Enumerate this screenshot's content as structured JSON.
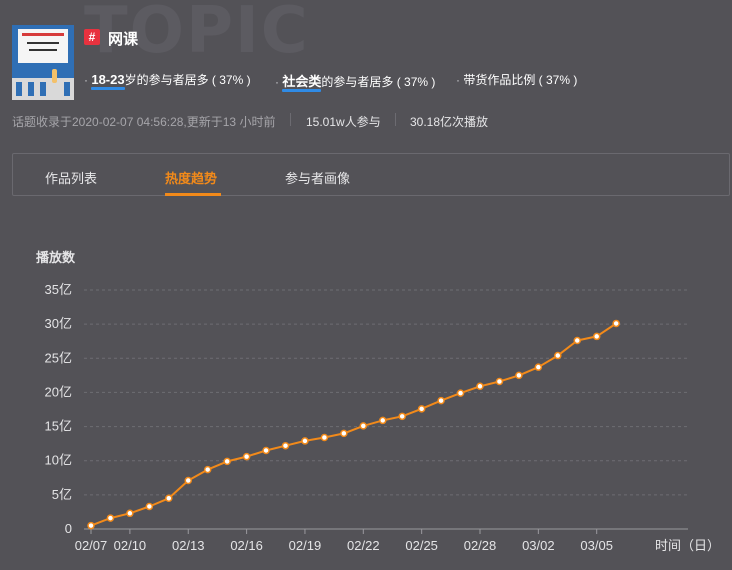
{
  "watermark": "TOPIC",
  "topic": {
    "hash_symbol": "#",
    "title": "网课",
    "cover_icon": "topic-cover-thumbnail"
  },
  "stats": [
    {
      "dot": "·",
      "highlight": "18-23",
      "rest": "岁的参与者居多 ( 37% )"
    },
    {
      "dot": "·",
      "highlight": "社会类",
      "rest": "的参与者居多 ( 37% )"
    },
    {
      "dot": "·",
      "highlight": "",
      "rest": "带货作品比例 ( 37% )"
    }
  ],
  "meta": {
    "included": "话题收录于2020-02-07 04:56:28,更新于13 小时前",
    "participants": "15.01w人参与",
    "plays": "30.18亿次播放"
  },
  "tabs": [
    {
      "label": "作品列表",
      "active": false
    },
    {
      "label": "热度趋势",
      "active": true
    },
    {
      "label": "参与者画像",
      "active": false
    }
  ],
  "colors": {
    "background": "#535257",
    "accent": "#f28a1a",
    "highlight_underline": "#2f8be6",
    "tag": "#e8323f"
  },
  "chart_data": {
    "type": "line",
    "ylabel": "播放数",
    "xlabel": "时间（日）",
    "y_unit": "亿",
    "ylim": [
      0,
      35
    ],
    "y_ticks": [
      {
        "value": 0,
        "label": "0"
      },
      {
        "value": 5,
        "label": "5亿"
      },
      {
        "value": 10,
        "label": "10亿"
      },
      {
        "value": 15,
        "label": "15亿"
      },
      {
        "value": 20,
        "label": "20亿"
      },
      {
        "value": 25,
        "label": "25亿"
      },
      {
        "value": 30,
        "label": "30亿"
      },
      {
        "value": 35,
        "label": "35亿"
      }
    ],
    "x_ticks": [
      "02/07",
      "02/10",
      "02/13",
      "02/16",
      "02/19",
      "02/22",
      "02/25",
      "02/28",
      "03/02",
      "03/05"
    ],
    "x": [
      "02/07",
      "02/09",
      "02/10",
      "02/11",
      "02/12",
      "02/13",
      "02/14",
      "02/15",
      "02/16",
      "02/17",
      "02/18",
      "02/19",
      "02/20",
      "02/21",
      "02/22",
      "02/23",
      "02/24",
      "02/25",
      "02/26",
      "02/27",
      "02/28",
      "02/29",
      "03/01",
      "03/02",
      "03/03",
      "03/04",
      "03/05",
      "03/06"
    ],
    "values": [
      0.5,
      1.6,
      2.3,
      3.3,
      4.5,
      7.1,
      8.7,
      9.9,
      10.6,
      11.5,
      12.2,
      12.9,
      13.4,
      14.0,
      15.1,
      15.9,
      16.5,
      17.6,
      18.8,
      19.9,
      20.9,
      21.6,
      22.5,
      23.7,
      25.4,
      27.6,
      28.2,
      30.1
    ],
    "grid": true,
    "legend": "none",
    "line_color": "#f28a1a"
  }
}
